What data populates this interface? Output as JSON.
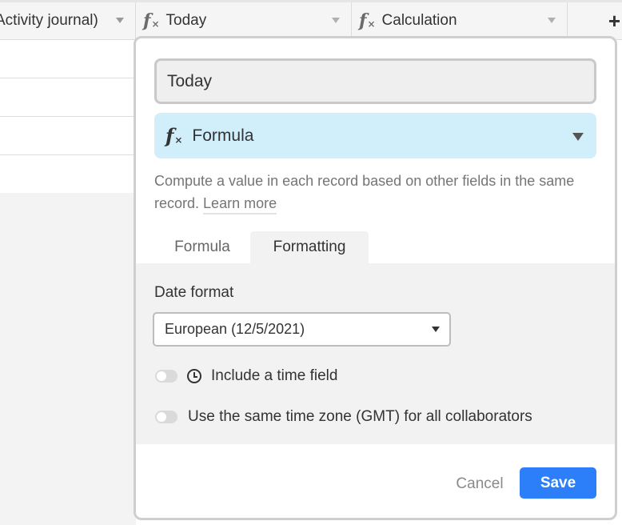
{
  "grid": {
    "columns": [
      {
        "label": "Activity journal)",
        "icon": null
      },
      {
        "label": "Today",
        "icon": "formula-icon"
      },
      {
        "label": "Calculation",
        "icon": "formula-icon"
      }
    ],
    "add_column_symbol": "+"
  },
  "field_editor": {
    "field_name": "Today",
    "field_type": {
      "label": "Formula",
      "icon": "formula-icon",
      "symbol": "f"
    },
    "description": "Compute a value in each record based on other fields in the same record.",
    "learn_more": "Learn more",
    "tabs": [
      {
        "label": "Formula",
        "active": false
      },
      {
        "label": "Formatting",
        "active": true
      }
    ],
    "formatting": {
      "date_format_label": "Date format",
      "date_format_value": "European (12/5/2021)",
      "include_time_label": "Include a time field",
      "include_time_enabled": false,
      "same_timezone_label": "Use the same time zone (GMT) for all collaborators",
      "same_timezone_enabled": false
    },
    "buttons": {
      "cancel": "Cancel",
      "save": "Save"
    }
  },
  "colors": {
    "accent": "#2d7ff9",
    "type_select_bg": "#d0effb",
    "panel_bg": "#f2f2f2"
  }
}
